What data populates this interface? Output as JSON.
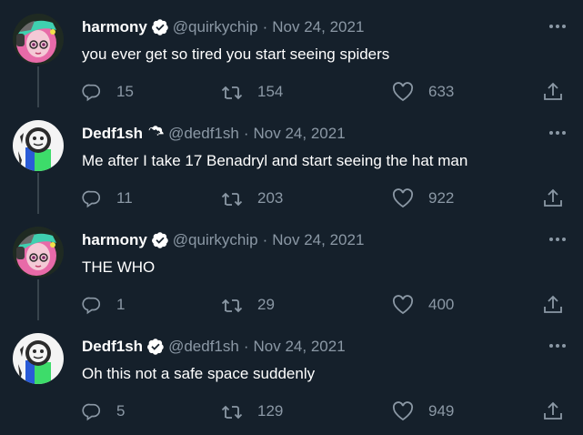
{
  "tweets": [
    {
      "name": "harmony",
      "handle": "@quirkychip",
      "separator": "·",
      "date": "Nov 24, 2021",
      "text": "you ever get so tired you start seeing spiders",
      "replies": "15",
      "retweets": "154",
      "likes": "633",
      "avatar": "harmony-avatar"
    },
    {
      "name": "Dedf1sh",
      "handle": "@dedf1sh",
      "separator": "·",
      "date": "Nov 24, 2021",
      "text": "Me after I take 17 Benadryl and start seeing the hat man",
      "replies": "11",
      "retweets": "203",
      "likes": "922",
      "avatar": "dedf1sh-avatar"
    },
    {
      "name": "harmony",
      "handle": "@quirkychip",
      "separator": "·",
      "date": "Nov 24, 2021",
      "text": "THE WHO",
      "replies": "1",
      "retweets": "29",
      "likes": "400",
      "avatar": "harmony-avatar"
    },
    {
      "name": "Dedf1sh",
      "handle": "@dedf1sh",
      "separator": "·",
      "date": "Nov 24, 2021",
      "text": "Oh this not a safe space suddenly",
      "replies": "5",
      "retweets": "129",
      "likes": "949",
      "avatar": "dedf1sh-avatar"
    }
  ],
  "icons": {
    "verified": "verified-badge-icon",
    "more": "more-horizontal-icon",
    "reply": "reply-icon",
    "retweet": "retweet-icon",
    "like": "heart-icon",
    "share": "share-icon"
  },
  "colors": {
    "background": "#15202b",
    "muted": "#8b98a5",
    "thread_line": "#38444d",
    "harmony_hair": "#e86aa8",
    "harmony_hat": "#3fd0b0",
    "dedf1sh_green": "#3ddc6a",
    "dedf1sh_blue": "#2a5bd7"
  }
}
